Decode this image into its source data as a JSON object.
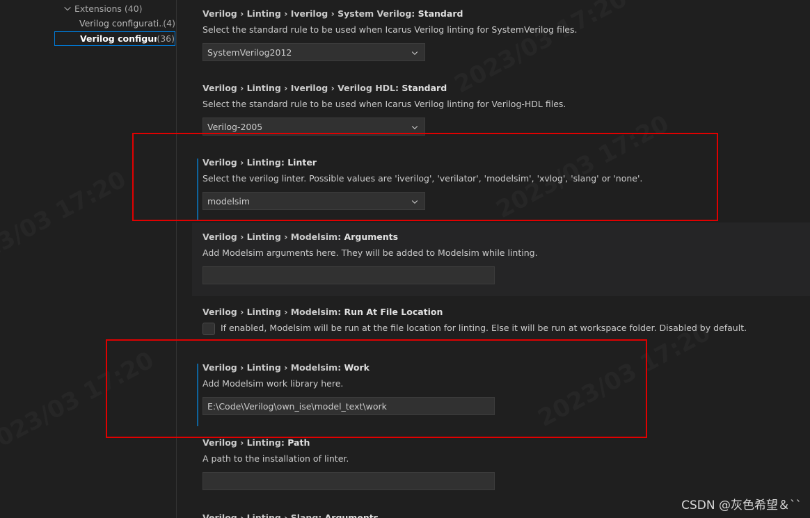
{
  "toc": {
    "extensions": {
      "label": "Extensions",
      "count": "(40)"
    },
    "items": [
      {
        "label": "Verilog configurati...",
        "count": "(4)"
      },
      {
        "label": "Verilog configur...",
        "count": "(36)"
      }
    ]
  },
  "settings": [
    {
      "category": "Verilog › Linting › Iverilog › System Verilog: ",
      "key": "Standard",
      "description": "Select the standard rule to be used when Icarus Verilog linting for SystemVerilog files.",
      "value": "SystemVerilog2012"
    },
    {
      "category": "Verilog › Linting › Iverilog › Verilog HDL: ",
      "key": "Standard",
      "description": "Select the standard rule to be used when Icarus Verilog linting for Verilog-HDL files.",
      "value": "Verilog-2005"
    },
    {
      "category": "Verilog › Linting: ",
      "key": "Linter",
      "description": "Select the verilog linter. Possible values are 'iverilog', 'verilator', 'modelsim', 'xvlog', 'slang' or 'none'.",
      "value": "modelsim"
    },
    {
      "category": "Verilog › Linting › Modelsim: ",
      "key": "Arguments",
      "description": "Add Modelsim arguments here. They will be added to Modelsim while linting.",
      "value": ""
    },
    {
      "category": "Verilog › Linting › Modelsim: ",
      "key": "Run At File Location",
      "description": "If enabled, Modelsim will be run at the file location for linting. Else it will be run at workspace folder. Disabled by default."
    },
    {
      "category": "Verilog › Linting › Modelsim: ",
      "key": "Work",
      "description": "Add Modelsim work library here.",
      "value": "E:\\Code\\Verilog\\own_ise\\model_text\\work"
    },
    {
      "category": "Verilog › Linting: ",
      "key": "Path",
      "description": "A path to the installation of linter.",
      "value": ""
    },
    {
      "category": "Verilog › Linting › Slang: ",
      "key": "Arguments"
    }
  ],
  "watermark": "CSDN @灰色希望＆``",
  "colors": {
    "annotation": "#e00000",
    "modified_bar": "#0e639c",
    "selection_border": "#0078d4"
  }
}
